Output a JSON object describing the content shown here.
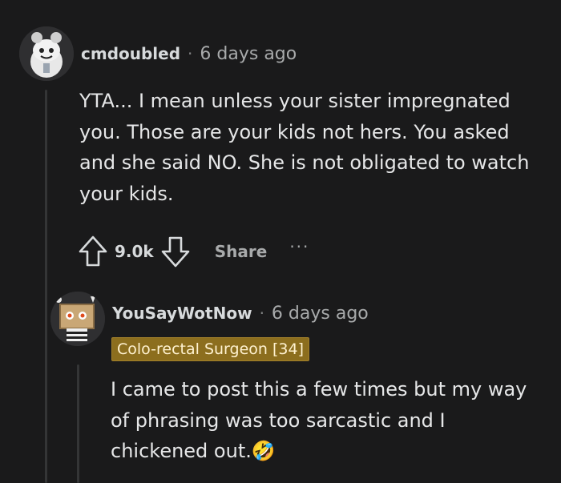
{
  "comment": {
    "username": "cmdoubled",
    "separator": "·",
    "timestamp": "6 days ago",
    "body": "YTA... I mean unless your sister impregnated you. Those are your kids not hers. You asked and she said NO. She is not obligated to watch your kids.",
    "upvote_icon": "upvote-arrow-icon",
    "vote_count": "9.0k",
    "downvote_icon": "downvote-arrow-icon",
    "share_label": "Share",
    "more_label": "···"
  },
  "reply": {
    "username": "YouSayWotNow",
    "separator": "·",
    "timestamp": "6 days ago",
    "flair": "Colo-rectal Surgeon [34]",
    "flair_color": "#8c6e1e",
    "body": "I came to post this a few times but my way of phrasing was too sarcastic and I chickened out.🤣"
  },
  "colors": {
    "background": "#1a1a1b",
    "text": "#d7dadc",
    "muted": "#818384"
  }
}
